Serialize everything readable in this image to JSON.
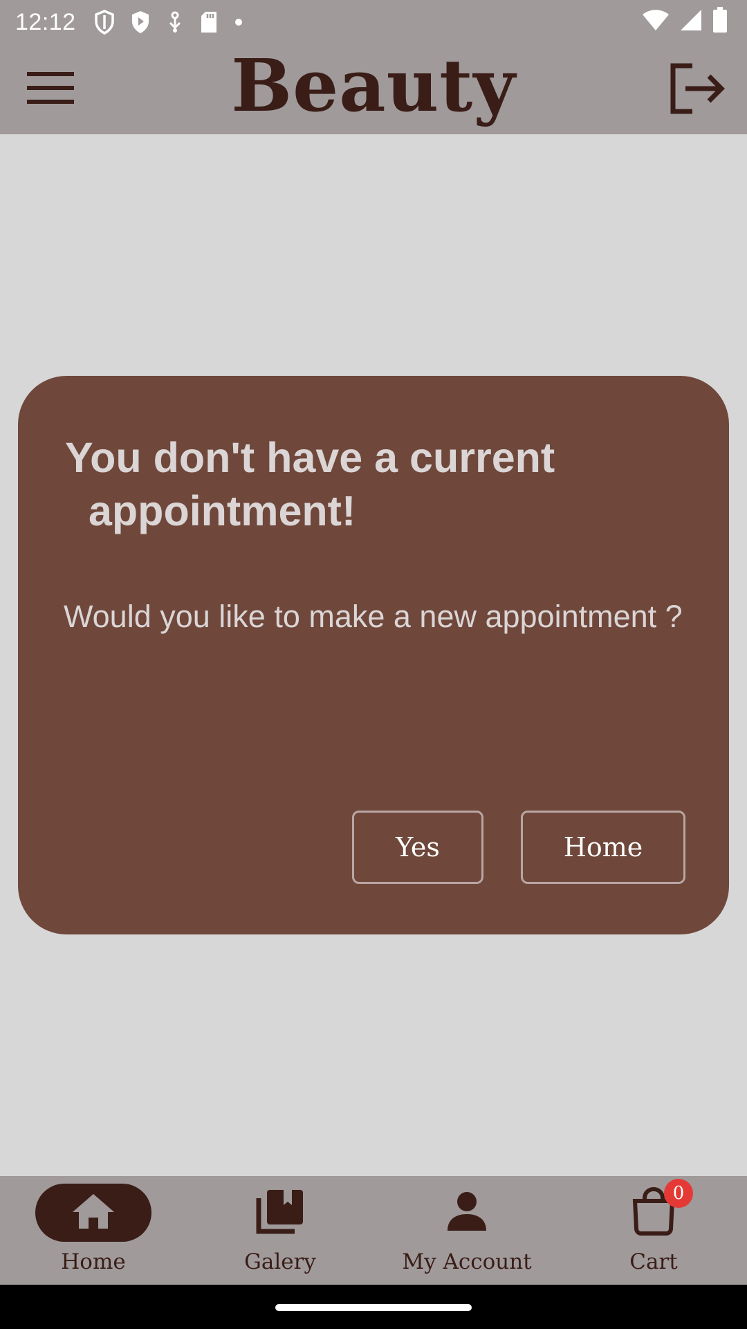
{
  "status_bar": {
    "time": "12:12",
    "left_icons": [
      "shield-outline-icon",
      "shield-play-icon",
      "download-arrow-icon",
      "sd-card-icon",
      "dot-icon"
    ],
    "right_icons": [
      "wifi-icon",
      "cellular-signal-icon",
      "battery-icon"
    ]
  },
  "app_bar": {
    "title": "Beauty",
    "menu_icon": "hamburger-menu-icon",
    "logout_icon": "logout-icon"
  },
  "dialog": {
    "title_line1": "You don't have a current",
    "title_line2": "appointment!",
    "message": "Would you like to make a new appointment ?",
    "yes_label": "Yes",
    "home_label": "Home"
  },
  "bottom_nav": {
    "items": [
      {
        "label": "Home",
        "icon": "home-icon",
        "active": true
      },
      {
        "label": "Galery",
        "icon": "gallery-icon",
        "active": false
      },
      {
        "label": "My Account",
        "icon": "person-icon",
        "active": false
      },
      {
        "label": "Cart",
        "icon": "shopping-bag-icon",
        "active": false,
        "badge": "0"
      }
    ]
  },
  "colors": {
    "app_bar_bg": "#a09a9b",
    "page_bg": "#d8d7d8",
    "dialog_bg": "#6f483b",
    "primary_dark": "#3a1d17",
    "badge": "#e53935"
  }
}
